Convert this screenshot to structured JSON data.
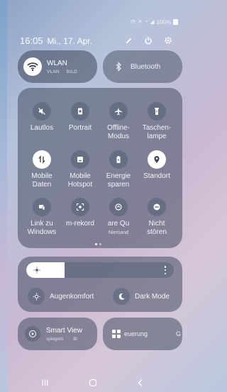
{
  "statusbar": {
    "battery": "100%",
    "icons": [
      "sync-icon",
      "mute-icon",
      "wifi-icon",
      "signal-icon",
      "battery-icon"
    ]
  },
  "header": {
    "time": "16:05",
    "date": "Mi., 17. Apr.",
    "actions": [
      "edit-icon",
      "power-icon",
      "settings-icon"
    ]
  },
  "toggles": {
    "wlan": {
      "title": "WLAN",
      "sub1": "VLAN",
      "sub2": "BILD",
      "icon": "wifi-icon",
      "state": "on"
    },
    "bluetooth": {
      "title": "Bluetooth",
      "icon": "bluetooth-icon",
      "state": "off"
    }
  },
  "grid": {
    "row1": [
      {
        "label1": "Lautlos",
        "label2": "",
        "icon": "mute-icon",
        "on": false
      },
      {
        "label1": "Portrait",
        "label2": "",
        "icon": "portrait-lock-icon",
        "on": false
      },
      {
        "label1": "Offline-",
        "label2": "Modus",
        "icon": "airplane-icon",
        "on": false
      },
      {
        "label1": "Taschen-",
        "label2": "lampe",
        "icon": "flashlight-icon",
        "on": false
      }
    ],
    "row2": [
      {
        "label1": "Mobile",
        "label2": "Daten",
        "icon": "mobile-data-icon",
        "on": true
      },
      {
        "label1": "Mobile",
        "label2": "Hotspot",
        "icon": "hotspot-icon",
        "on": false
      },
      {
        "label1": "Energie",
        "label2": "sparen",
        "icon": "battery-saver-icon",
        "on": false
      },
      {
        "label1": "Standort",
        "label2": "",
        "icon": "location-icon",
        "on": true
      }
    ],
    "row3": [
      {
        "label1": "Link zu",
        "label2": "Windows",
        "icon": "link-windows-icon",
        "on": false
      },
      {
        "label1": "m-rekord",
        "label2": "",
        "icon": "screen-record-icon",
        "on": false
      },
      {
        "label1": "are   Qu",
        "label2": "Niemand",
        "icon": "quick-share-icon",
        "on": false
      },
      {
        "label1": "Nicht",
        "label2": "stören",
        "icon": "do-not-disturb-icon",
        "on": false
      }
    ]
  },
  "brightness": {
    "level_percent": 26,
    "sun_icon": "sun-icon",
    "more_icon": "more-vertical-icon"
  },
  "modes": {
    "eye_comfort": "Augenkomfort",
    "dark_mode": "Dark Mode"
  },
  "bottom": {
    "smart_view": {
      "title": "Smart View",
      "sub1": "spiegeln",
      "sub2": "Bi"
    },
    "device_control": {
      "label": "euerung",
      "trailing": "G"
    }
  },
  "nav": {
    "recents": "III",
    "home": "home-icon",
    "back": "back-icon"
  }
}
